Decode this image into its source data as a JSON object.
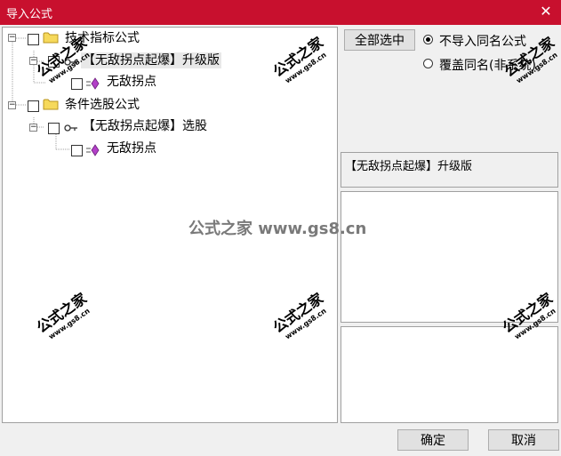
{
  "window": {
    "title": "导入公式",
    "close_glyph": "✕"
  },
  "tree": {
    "nodes": [
      {
        "label": "技术指标公式"
      },
      {
        "label": "【无敌拐点起爆】升级版"
      },
      {
        "label": "无敌拐点"
      },
      {
        "label": "条件选股公式"
      },
      {
        "label": "【无敌拐点起爆】选股"
      },
      {
        "label": "无敌拐点"
      }
    ]
  },
  "right": {
    "select_all_label": "全部选中",
    "radio_options": [
      {
        "label": "不导入同名公式",
        "checked": true
      },
      {
        "label": "覆盖同名(非系统)",
        "checked": false
      }
    ],
    "selected_info": "【无敌拐点起爆】升级版"
  },
  "footer": {
    "ok_label": "确定",
    "cancel_label": "取消"
  },
  "watermark": {
    "text": "公式之家",
    "site": "www.gs8.cn",
    "center_text": "公式之家 www.gs8.cn"
  },
  "colors": {
    "titlebar": "#c8102e",
    "formula_icon": "#b23fc7"
  }
}
